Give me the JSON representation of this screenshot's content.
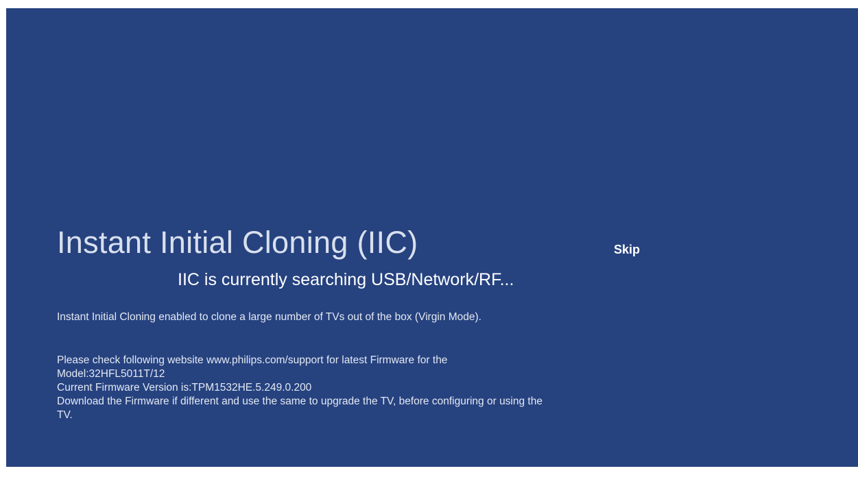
{
  "colors": {
    "screen_background": "#26427f",
    "text": "#ffffff"
  },
  "title": "Instant Initial Cloning (IIC)",
  "status": "IIC is currently searching USB/Network/RF...",
  "skip_label": "Skip",
  "description": "Instant Initial Cloning enabled to clone a large number of TVs out of the box (Virgin Mode).",
  "info": {
    "check_website": "Please check following website www.philips.com/support for latest Firmware for the",
    "model": "Model:32HFL5011T/12",
    "firmware_version": "Current Firmware Version is:TPM1532HE.5.249.0.200",
    "download_instruction": "Download the Firmware if different and use the same to upgrade the TV, before configuring or using the TV."
  }
}
